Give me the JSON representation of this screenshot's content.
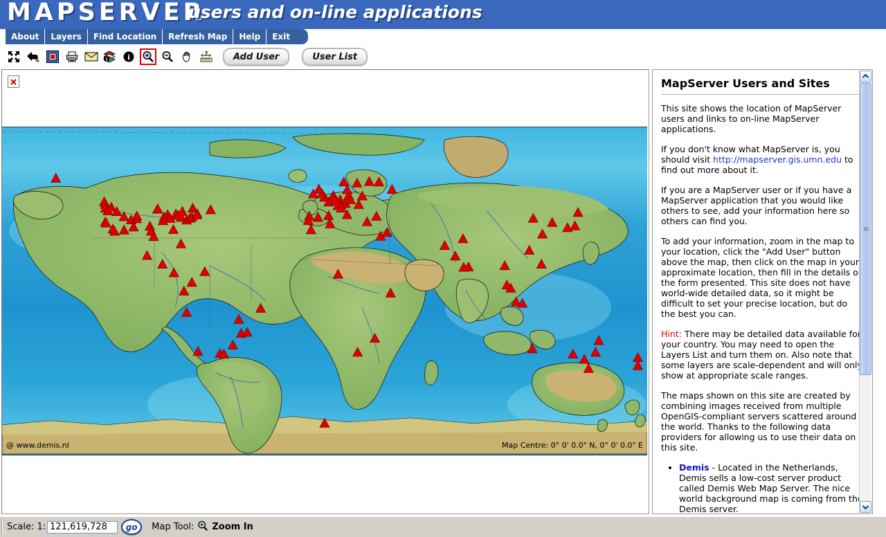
{
  "banner": {
    "logo": "MAPSERVER",
    "tagline": "users and on-line applications",
    "bg_color": "#3A68BD"
  },
  "menu": {
    "items": [
      {
        "label": "About",
        "name": "menu-item-about"
      },
      {
        "label": "Layers",
        "name": "menu-item-layers"
      },
      {
        "label": "Find Location",
        "name": "menu-item-find-location"
      },
      {
        "label": "Refresh Map",
        "name": "menu-item-refresh-map"
      },
      {
        "label": "Help",
        "name": "menu-item-help"
      },
      {
        "label": "Exit",
        "name": "menu-item-exit"
      }
    ]
  },
  "toolbar": {
    "icons_left": [
      {
        "icon": "zoom-full-extent-icon"
      },
      {
        "icon": "back-arrow-icon"
      },
      {
        "icon": "reference-map-icon"
      },
      {
        "icon": "print-icon"
      },
      {
        "icon": "email-icon"
      }
    ],
    "icons_right": [
      {
        "icon": "layer-info-icon"
      },
      {
        "icon": "info-icon"
      },
      {
        "icon": "zoom-in-icon",
        "selected": true
      },
      {
        "icon": "zoom-out-icon"
      },
      {
        "icon": "pan-hand-icon"
      },
      {
        "icon": "measure-icon"
      }
    ],
    "add_user_label": "Add User",
    "user_list_label": "User List"
  },
  "map": {
    "broken_image_alt": "x",
    "attribution": "@ www.demis.nl",
    "centre_label": "Map Centre: 0° 0' 0.0\" N, 0° 0' 0.0\" E",
    "marker_color": "#E00000",
    "ocean_color": "#2EA6D8"
  },
  "info": {
    "title": "MapServer Users and Sites",
    "p1": "This site shows the location of MapServer users and links to on-line MapServer applications.",
    "p2_before": "If you don't know what MapServer is, you should visit ",
    "p2_link": "http://mapserver.gis.umn.edu",
    "p2_after": " to find out more about it.",
    "p3": "If you are a MapServer user or if you have a MapServer application that you would like others to see, add your information here so others can find you.",
    "p4": "To add your information, zoom in the map to your location, click the \"Add User\" button above the map, then click on the map in your approximate location, then fill in the details on the form presented. This site does not have world-wide detailed data, so it might be difficult to set your precise location, but do the best you can.",
    "hint_label": "Hint:",
    "p5": " There may be detailed data available for your country. You may need to open the Layers List and turn them on. Also note that some layers are scale-dependent and will only show at appropriate scale ranges.",
    "p6": "The maps shown on this site are created by combining images received from multiple OpenGIS-compliant servers scattered around the world. Thanks to the following data providers for allowing us to use their data on this site.",
    "providers": [
      {
        "name": "Demis",
        "text": " - Located in the Netherlands, Demis sells a low-cost server product called Demis Web Map Server. The nice world background map is coming from the Demis server."
      }
    ]
  },
  "status": {
    "scale_label": "Scale:  1:",
    "scale_value": "121,619,728",
    "go_label": "go",
    "maptool_label": "Map Tool:",
    "maptool_value": "Zoom In"
  },
  "chart_data": {
    "type": "map",
    "projection": "world-equirectangular",
    "marker_type": "triangle",
    "marker_color": "#E00000",
    "markers": [
      {
        "lon": -150.0,
        "lat": 62.0
      },
      {
        "lon": -123.0,
        "lat": 49.0
      },
      {
        "lon": -122.5,
        "lat": 47.6
      },
      {
        "lon": -122.3,
        "lat": 45.5
      },
      {
        "lon": -121.0,
        "lat": 44.0
      },
      {
        "lon": -119.0,
        "lat": 46.0
      },
      {
        "lon": -122.4,
        "lat": 37.8
      },
      {
        "lon": -121.9,
        "lat": 37.3
      },
      {
        "lon": -118.2,
        "lat": 34.0
      },
      {
        "lon": -117.2,
        "lat": 32.7
      },
      {
        "lon": -116.0,
        "lat": 43.6
      },
      {
        "lon": -112.0,
        "lat": 40.8
      },
      {
        "lon": -111.9,
        "lat": 33.4
      },
      {
        "lon": -108.0,
        "lat": 39.0
      },
      {
        "lon": -105.0,
        "lat": 39.7
      },
      {
        "lon": -104.8,
        "lat": 41.1
      },
      {
        "lon": -106.6,
        "lat": 35.1
      },
      {
        "lon": -97.5,
        "lat": 35.5
      },
      {
        "lon": -96.8,
        "lat": 32.8
      },
      {
        "lon": -95.4,
        "lat": 29.8
      },
      {
        "lon": -93.3,
        "lat": 44.9
      },
      {
        "lon": -93.1,
        "lat": 45.0
      },
      {
        "lon": -90.2,
        "lat": 38.6
      },
      {
        "lon": -89.6,
        "lat": 40.7
      },
      {
        "lon": -87.6,
        "lat": 41.9
      },
      {
        "lon": -86.2,
        "lat": 39.8
      },
      {
        "lon": -84.4,
        "lat": 33.7
      },
      {
        "lon": -83.0,
        "lat": 42.3
      },
      {
        "lon": -81.7,
        "lat": 41.5
      },
      {
        "lon": -80.0,
        "lat": 40.4
      },
      {
        "lon": -79.4,
        "lat": 43.7
      },
      {
        "lon": -77.0,
        "lat": 38.9
      },
      {
        "lon": -75.2,
        "lat": 40.0
      },
      {
        "lon": -74.0,
        "lat": 40.7
      },
      {
        "lon": -73.6,
        "lat": 45.5
      },
      {
        "lon": -71.1,
        "lat": 42.4
      },
      {
        "lon": -71.4,
        "lat": 41.8
      },
      {
        "lon": -63.6,
        "lat": 44.6
      },
      {
        "lon": -80.2,
        "lat": 25.8
      },
      {
        "lon": -99.1,
        "lat": 19.4
      },
      {
        "lon": -90.5,
        "lat": 14.6
      },
      {
        "lon": -84.1,
        "lat": 9.9
      },
      {
        "lon": -74.1,
        "lat": 4.6
      },
      {
        "lon": -66.9,
        "lat": 10.5
      },
      {
        "lon": -78.5,
        "lat": -0.2
      },
      {
        "lon": -77.0,
        "lat": -12.0
      },
      {
        "lon": -70.7,
        "lat": -33.5
      },
      {
        "lon": -58.4,
        "lat": -34.6
      },
      {
        "lon": -56.2,
        "lat": -34.9
      },
      {
        "lon": -47.9,
        "lat": -15.8
      },
      {
        "lon": -46.6,
        "lat": -23.5
      },
      {
        "lon": -43.2,
        "lat": -22.9
      },
      {
        "lon": -51.2,
        "lat": -30.0
      },
      {
        "lon": -35.7,
        "lat": -9.7
      },
      {
        "lon": -8.6,
        "lat": 41.1
      },
      {
        "lon": -9.1,
        "lat": 38.7
      },
      {
        "lon": -3.7,
        "lat": 40.4
      },
      {
        "lon": 2.2,
        "lat": 41.4
      },
      {
        "lon": -0.1,
        "lat": 51.5
      },
      {
        "lon": -1.5,
        "lat": 53.4
      },
      {
        "lon": -3.2,
        "lat": 55.9
      },
      {
        "lon": -6.3,
        "lat": 53.3
      },
      {
        "lon": 2.3,
        "lat": 48.9
      },
      {
        "lon": 4.9,
        "lat": 52.4
      },
      {
        "lon": 4.4,
        "lat": 50.8
      },
      {
        "lon": 6.1,
        "lat": 49.6
      },
      {
        "lon": 8.7,
        "lat": 50.1
      },
      {
        "lon": 13.4,
        "lat": 52.5
      },
      {
        "lon": 11.6,
        "lat": 48.1
      },
      {
        "lon": 9.2,
        "lat": 47.4
      },
      {
        "lon": 7.4,
        "lat": 46.9
      },
      {
        "lon": 12.5,
        "lat": 41.9
      },
      {
        "lon": 9.2,
        "lat": 45.5
      },
      {
        "lon": 14.4,
        "lat": 50.1
      },
      {
        "lon": 19.0,
        "lat": 47.5
      },
      {
        "lon": 21.0,
        "lat": 52.2
      },
      {
        "lon": 18.1,
        "lat": 59.3
      },
      {
        "lon": 10.7,
        "lat": 59.9
      },
      {
        "lon": 12.6,
        "lat": 55.7
      },
      {
        "lon": 24.9,
        "lat": 60.2
      },
      {
        "lon": 37.6,
        "lat": 55.8
      },
      {
        "lon": 30.3,
        "lat": 59.9
      },
      {
        "lon": 28.9,
        "lat": 41.0
      },
      {
        "lon": 23.7,
        "lat": 38.0
      },
      {
        "lon": 34.8,
        "lat": 32.1
      },
      {
        "lon": 31.2,
        "lat": 30.0
      },
      {
        "lon": 3.0,
        "lat": 36.8
      },
      {
        "lon": -7.6,
        "lat": 33.6
      },
      {
        "lon": 7.5,
        "lat": 9.1
      },
      {
        "lon": 28.0,
        "lat": -26.2
      },
      {
        "lon": 18.4,
        "lat": -33.9
      },
      {
        "lon": 36.8,
        "lat": -1.3
      },
      {
        "lon": 77.2,
        "lat": 28.6
      },
      {
        "lon": 72.9,
        "lat": 19.1
      },
      {
        "lon": 80.3,
        "lat": 13.1
      },
      {
        "lon": 77.6,
        "lat": 12.9
      },
      {
        "lon": 67.0,
        "lat": 24.9
      },
      {
        "lon": 100.5,
        "lat": 13.8
      },
      {
        "lon": 103.8,
        "lat": 1.4
      },
      {
        "lon": 101.7,
        "lat": 3.1
      },
      {
        "lon": 106.8,
        "lat": -6.2
      },
      {
        "lon": 110.4,
        "lat": -7.0
      },
      {
        "lon": 121.0,
        "lat": 14.6
      },
      {
        "lon": 114.2,
        "lat": 22.3
      },
      {
        "lon": 116.4,
        "lat": 39.9
      },
      {
        "lon": 121.5,
        "lat": 31.2
      },
      {
        "lon": 127.0,
        "lat": 37.6
      },
      {
        "lon": 139.7,
        "lat": 35.7
      },
      {
        "lon": 135.5,
        "lat": 34.7
      },
      {
        "lon": 141.4,
        "lat": 43.1
      },
      {
        "lon": 151.2,
        "lat": -33.9
      },
      {
        "lon": 144.9,
        "lat": -37.8
      },
      {
        "lon": 153.0,
        "lat": -27.5
      },
      {
        "lon": 138.6,
        "lat": -34.9
      },
      {
        "lon": 115.9,
        "lat": -32.0
      },
      {
        "lon": 147.3,
        "lat": -42.9
      },
      {
        "lon": 174.8,
        "lat": -36.9
      },
      {
        "lon": 174.8,
        "lat": -41.3
      },
      {
        "lon": 0.0,
        "lat": -73.0
      }
    ]
  }
}
